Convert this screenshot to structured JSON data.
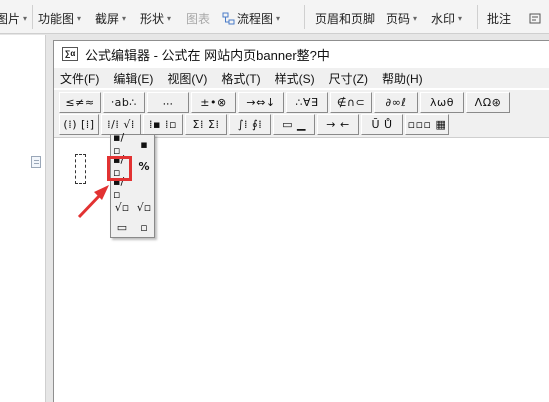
{
  "ribbon": {
    "items": [
      {
        "label": "图片",
        "icon": "picture-icon",
        "caret": "▾",
        "disabled": false
      },
      {
        "label": "功能图",
        "icon": "feature-chart-icon",
        "caret": "▾",
        "disabled": false
      },
      {
        "label": "截屏",
        "icon": "screenshot-icon",
        "caret": "▾",
        "disabled": false
      },
      {
        "label": "形状",
        "icon": "shape-icon",
        "caret": "▾",
        "disabled": false
      },
      {
        "label": "图表",
        "icon": "chart-icon",
        "caret": "",
        "disabled": true
      },
      {
        "label": "流程图",
        "icon": "flowchart-icon",
        "caret": "▾",
        "disabled": false
      },
      {
        "label": "页眉和页脚",
        "icon": "header-footer-icon",
        "caret": "",
        "disabled": false
      },
      {
        "label": "页码",
        "icon": "page-number-icon",
        "caret": "▾",
        "disabled": false
      },
      {
        "label": "水印",
        "icon": "watermark-icon",
        "caret": "▾",
        "disabled": false
      },
      {
        "label": "批注",
        "icon": "comment-icon",
        "caret": "",
        "disabled": false
      },
      {
        "label": "",
        "icon": "more-icon",
        "caret": "",
        "disabled": false
      }
    ]
  },
  "editor": {
    "app_icon_text": "∑α",
    "title": "公式编辑器 - 公式在 网站内页banner整?中",
    "menu": [
      "文件(F)",
      "编辑(E)",
      "视图(V)",
      "格式(T)",
      "样式(S)",
      "尺寸(Z)",
      "帮助(H)"
    ],
    "toolbar_row1": [
      "≤≠≈",
      "⸱ab∴",
      "⸳⸳⸳",
      "±•⊗",
      "→⇔↓",
      "∴∀∃",
      "∉∩⊂",
      "∂∞ℓ",
      "λωθ",
      "ΛΩ⊛"
    ],
    "toolbar_row2": [
      "(⁞) [⁞]",
      "⁞/⁞ √⁞",
      "⁞▪ ⁞▫",
      "Σ⁞ Σ⁞",
      "∫⁞ ∮⁞",
      "▭ ▁",
      "→ ←",
      "Ū Ů",
      "▫▫▫ ▦"
    ],
    "slot_glyph": "⁞",
    "palette": [
      "▪/▫",
      "▪",
      "▪/▫",
      "%",
      "▪/▫",
      "",
      "√▫",
      "√▫",
      "▭",
      "▫"
    ]
  },
  "colors": {
    "highlight": "#e23232",
    "arrow": "#e23232"
  }
}
